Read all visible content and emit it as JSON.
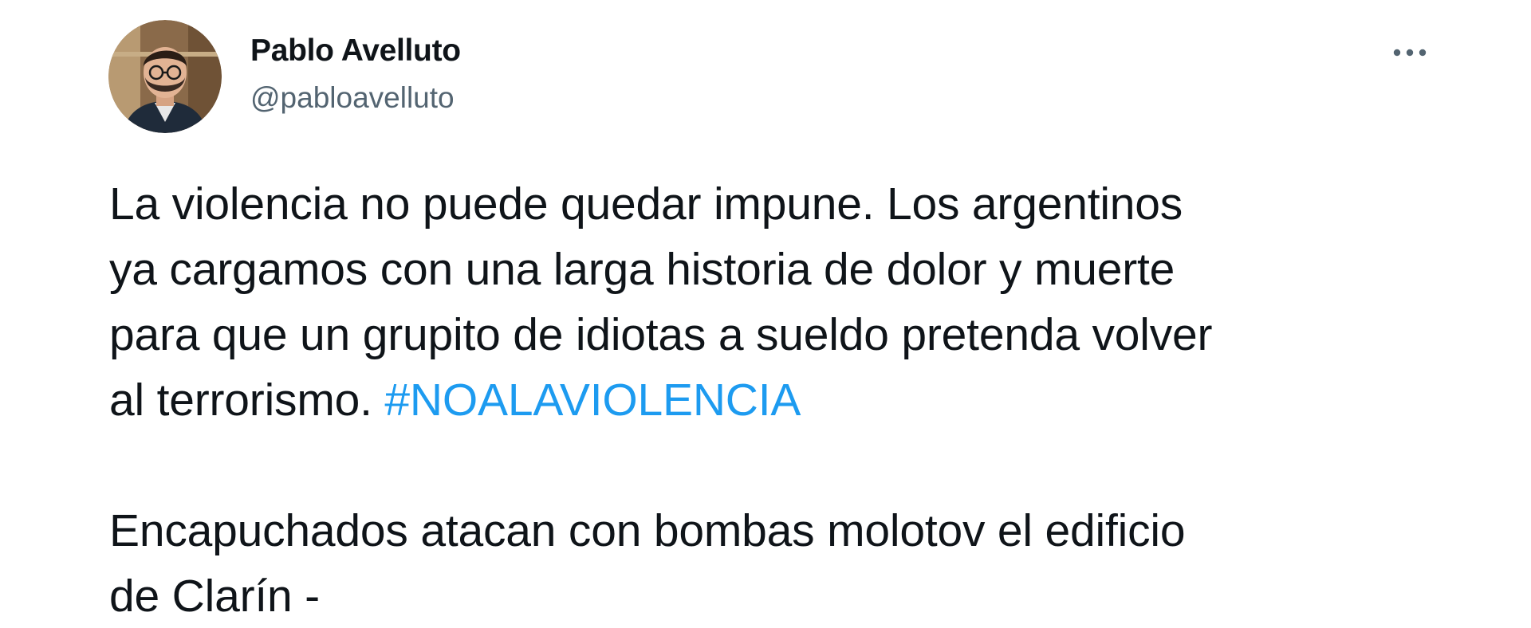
{
  "tweet": {
    "author": {
      "display_name": "Pablo Avelluto",
      "handle": "@pabloavelluto"
    },
    "more_icon": "more-horizontal-icon",
    "text_lines": [
      "La violencia no puede quedar impune. Los argentinos",
      "ya cargamos con una larga historia de dolor y muerte",
      "para que un grupito de idiotas a sueldo pretenda volver",
      "al terrorismo. "
    ],
    "hashtag": "#NOALAVIOLENCIA",
    "quote_lines": [
      "Encapuchados atacan con bombas molotov el edificio",
      "de Clarín -"
    ]
  },
  "colors": {
    "text": "#0f1419",
    "secondary": "#536471",
    "link": "#1d9bf0",
    "background": "#ffffff"
  }
}
